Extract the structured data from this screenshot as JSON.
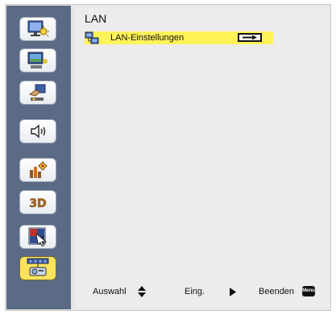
{
  "window": {
    "title": "LAN"
  },
  "sidebar": {
    "items": [
      {
        "name": "display",
        "icon": "display-brightness-icon"
      },
      {
        "name": "image",
        "icon": "image-settings-icon"
      },
      {
        "name": "settings",
        "icon": "projector-settings-icon"
      },
      {
        "name": "volume",
        "icon": "volume-icon"
      },
      {
        "name": "options",
        "icon": "options-icon"
      },
      {
        "name": "3d",
        "icon": "3d-icon",
        "label": "3D"
      },
      {
        "name": "interactive",
        "icon": "pointer-icon"
      },
      {
        "name": "lan",
        "icon": "network-projector-icon",
        "active": true
      }
    ]
  },
  "main": {
    "rows": [
      {
        "label": "LAN-Einstellungen",
        "icon": "network-settings-icon",
        "action_icon": "arrow-right-icon"
      }
    ]
  },
  "footer": {
    "select_label": "Auswahl",
    "enter_label": "Eing.",
    "exit_label": "Beenden",
    "menu_key_label": "Menu"
  },
  "colors": {
    "sidebar_bg": "#5b6b86",
    "highlight": "#fff35a",
    "active_button": "#ffe35c",
    "panel_bg": "#ececec"
  }
}
